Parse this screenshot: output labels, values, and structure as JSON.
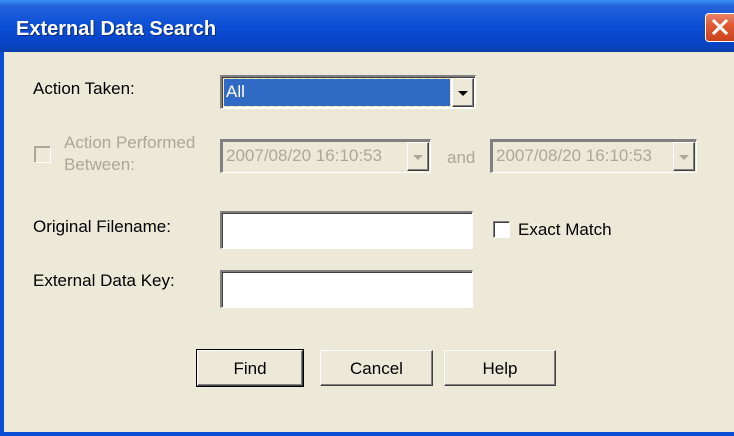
{
  "window": {
    "title": "External Data Search",
    "close_icon": "close-icon"
  },
  "form": {
    "action_taken_label": "Action Taken:",
    "action_taken_value": "All",
    "performed_between_line1": "Action Performed",
    "performed_between_line2": "Between:",
    "from_datetime": "2007/08/20  16:10:53",
    "and_label": "and",
    "to_datetime": "2007/08/20  16:10:53",
    "original_filename_label": "Original Filename:",
    "original_filename_value": "",
    "exact_match_label": "Exact Match",
    "external_data_key_label": "External Data Key:",
    "external_data_key_value": ""
  },
  "buttons": {
    "find": "Find",
    "cancel": "Cancel",
    "help": "Help"
  },
  "colors": {
    "titlebar": "#0a4ed6",
    "face": "#ece9d8",
    "selection": "#316ac5",
    "close": "#e05a34"
  }
}
